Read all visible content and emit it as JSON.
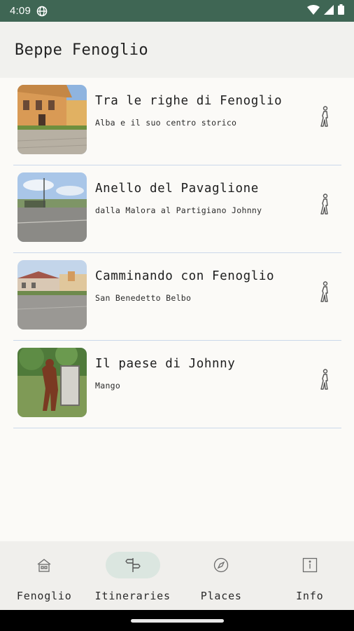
{
  "status": {
    "time": "4:09"
  },
  "appbar": {
    "title": "Beppe Fenoglio"
  },
  "itineraries": [
    {
      "title": "Tra le righe di Fenoglio",
      "subtitle": "Alba e il suo centro storico"
    },
    {
      "title": "Anello del Pavaglione",
      "subtitle": "dalla Malora al Partigiano Johnny"
    },
    {
      "title": "Camminando con Fenoglio",
      "subtitle": "San Benedetto Belbo"
    },
    {
      "title": "Il paese di Johnny",
      "subtitle": "Mango"
    }
  ],
  "nav": [
    {
      "label": "Fenoglio",
      "icon": "home-icon"
    },
    {
      "label": "Itineraries",
      "icon": "signpost-icon",
      "active": true
    },
    {
      "label": "Places",
      "icon": "compass-icon"
    },
    {
      "label": "Info",
      "icon": "info-icon"
    }
  ],
  "colors": {
    "statusbar": "#3f6654",
    "appbar": "#f1f1ee",
    "background": "#fbfaf7",
    "divider": "#cbd8ea",
    "nav_active_pill": "#dbe6e0"
  }
}
